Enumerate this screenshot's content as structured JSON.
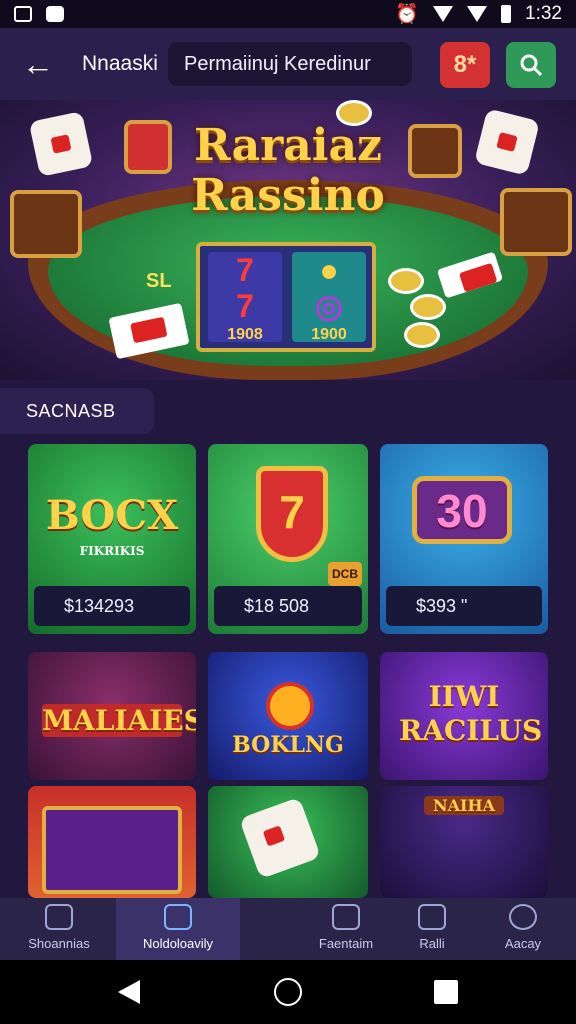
{
  "status_bar": {
    "time": "1:32"
  },
  "app_bar": {
    "title": "Nnaaski",
    "search_text": "Permaiinuj Keredinur",
    "red_button_label": "8*"
  },
  "hero": {
    "title_line1": "Raraiaz",
    "title_line2": "Rassino",
    "table_text": "SL",
    "reel1_symbol1": "7",
    "reel1_symbol2": "7",
    "reel1_amount": "1908",
    "reel2_amount": "1900"
  },
  "section": {
    "label": "SACNASB"
  },
  "games": [
    {
      "title": "BOCX",
      "subtitle": "FIKRIKIS",
      "price": "$134293",
      "bg": "#1f8a3a"
    },
    {
      "title": "7",
      "badge": "DCB",
      "price": "$18 508",
      "bg": "#2aa04a"
    },
    {
      "title": "30",
      "price": "$393 \"",
      "bg": "#1c6fb8"
    },
    {
      "title": "MALIAIES",
      "bg": "#5a1f4a"
    },
    {
      "title": "BOKLNG",
      "bg": "#2a3aa0"
    },
    {
      "title": "IIWI RACILUS",
      "bg": "#5a2a9a"
    },
    {
      "title": "",
      "bg": "#7a4a2a"
    },
    {
      "title": "",
      "bg": "#1f8a4a"
    },
    {
      "title": "NAIHA",
      "bg": "#3a1f5a"
    }
  ],
  "bottom_nav": [
    {
      "label": "Shoannias"
    },
    {
      "label": "Noldoloavily"
    },
    {
      "label": "Faentaim"
    },
    {
      "label": "Ralli"
    },
    {
      "label": "Aacay"
    }
  ],
  "colors": {
    "accent": "#ffd24a",
    "background": "#22173f",
    "red_button": "#d43232",
    "green_button": "#2f9a57"
  }
}
